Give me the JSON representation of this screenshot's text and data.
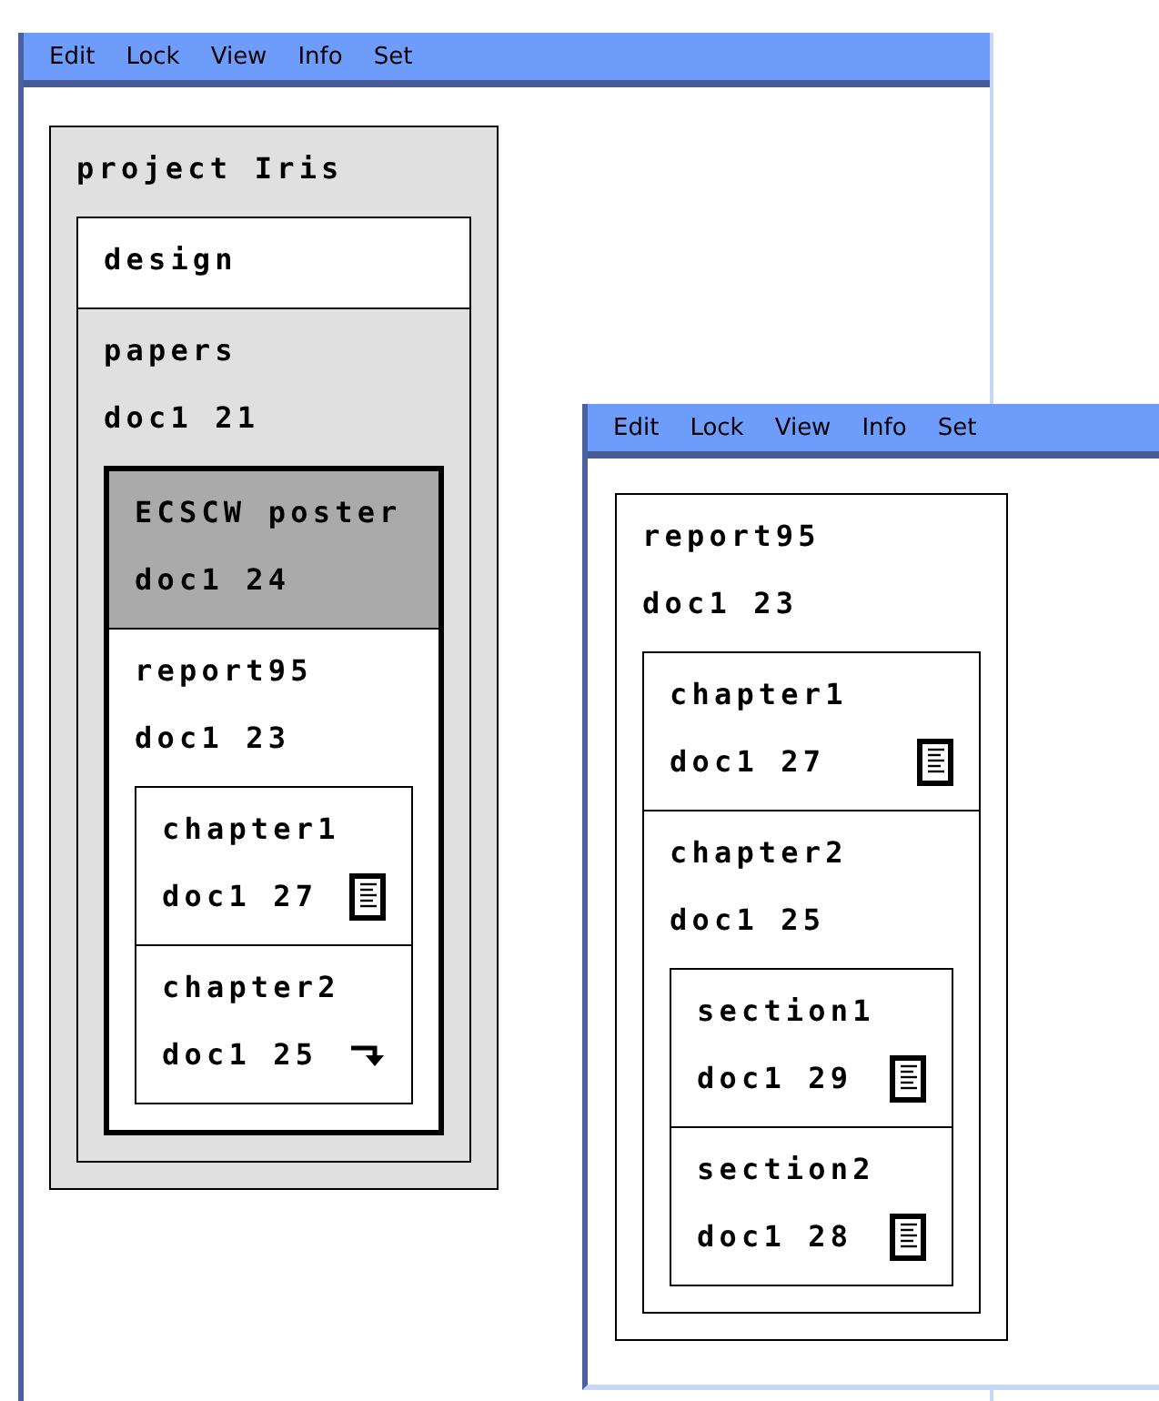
{
  "windows": [
    {
      "menu": [
        "Edit",
        "Lock",
        "View",
        "Info",
        "Set"
      ],
      "tree": [
        {
          "title": "project Iris",
          "kind": "group",
          "selected": false,
          "focused": false,
          "children": [
            {
              "title": "design",
              "kind": "item",
              "selected": false
            },
            {
              "title": "papers",
              "doc": "doc1 21",
              "kind": "group",
              "selected": false,
              "focused": true,
              "children": [
                {
                  "title": "ECSCW poster",
                  "doc": "doc1 24",
                  "kind": "item",
                  "selected": true
                },
                {
                  "title": "report95",
                  "doc": "doc1 23",
                  "kind": "item",
                  "selected": false,
                  "focused": false,
                  "children": [
                    {
                      "title": "chapter1",
                      "doc": "doc1 27",
                      "kind": "document",
                      "selected": false
                    },
                    {
                      "title": "chapter2",
                      "doc": "doc1 25",
                      "kind": "link",
                      "selected": false
                    }
                  ]
                }
              ]
            }
          ]
        }
      ]
    },
    {
      "menu": [
        "Edit",
        "Lock",
        "View",
        "Info",
        "Set"
      ],
      "tree": [
        {
          "title": "report95",
          "doc": "doc1 23",
          "kind": "item",
          "selected": false,
          "focused": false,
          "children": [
            {
              "title": "chapter1",
              "doc": "doc1 27",
              "kind": "document",
              "selected": false
            },
            {
              "title": "chapter2",
              "doc": "doc1 25",
              "kind": "item",
              "selected": false,
              "focused": false,
              "children": [
                {
                  "title": "section1",
                  "doc": "doc1 29",
                  "kind": "document",
                  "selected": false
                },
                {
                  "title": "section2",
                  "doc": "doc1 28",
                  "kind": "document",
                  "selected": false
                }
              ]
            }
          ]
        }
      ]
    }
  ]
}
